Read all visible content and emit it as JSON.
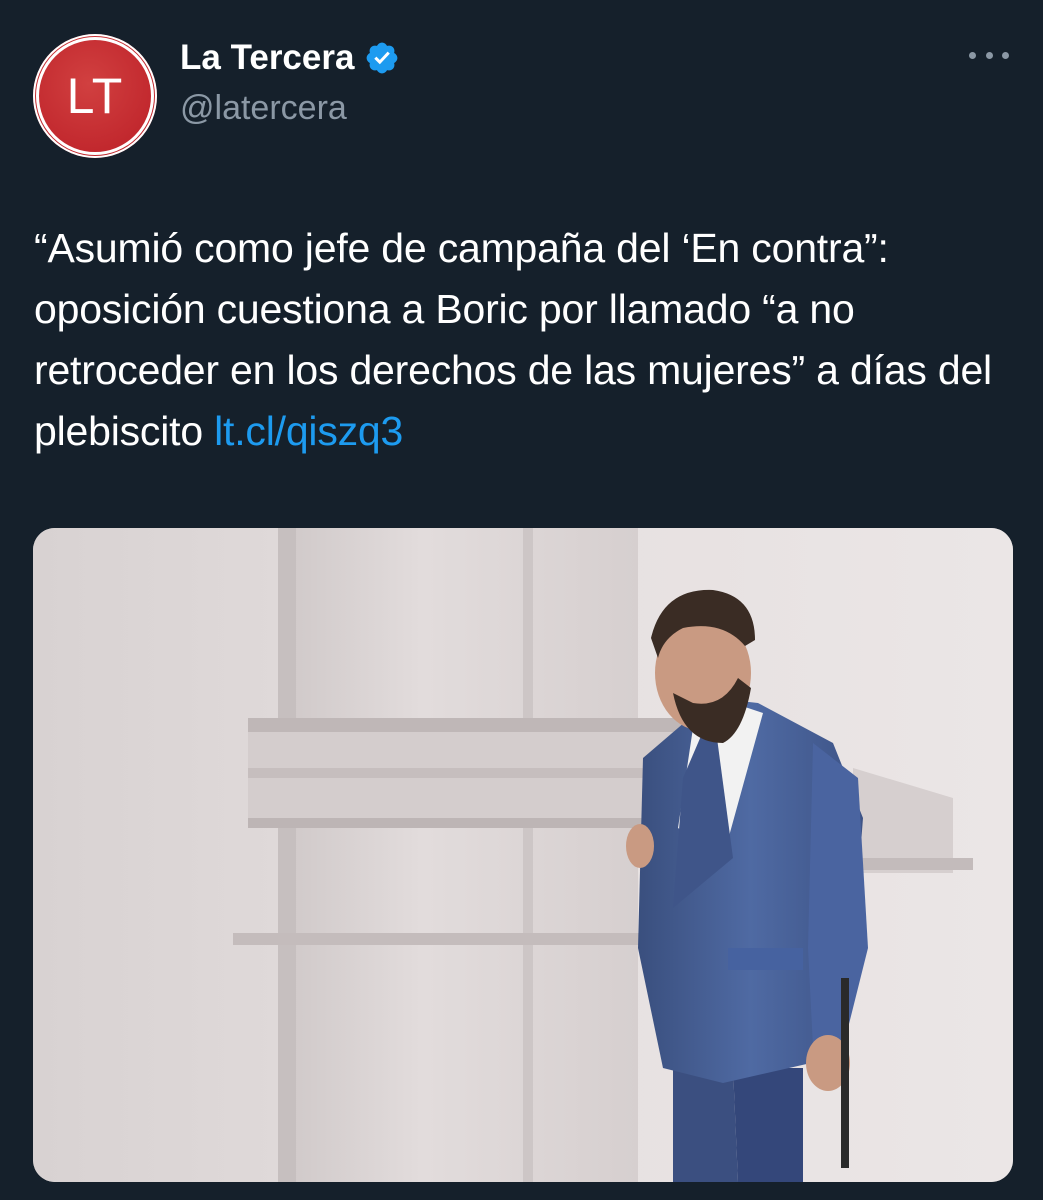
{
  "account": {
    "avatar_text": "LT",
    "display_name": "La Tercera",
    "handle": "@latercera",
    "verified": true,
    "verified_icon": "verified-badge-icon",
    "more_icon": "more-options-icon"
  },
  "tweet": {
    "text": "“Asumió como jefe de campaña del ‘En contra”: oposición cuestiona a Boric por llamado “a no retroceder en los derechos de las mujeres” a días del plebiscito ",
    "link": "lt.cl/qiszq3"
  },
  "media": {
    "type": "photo"
  },
  "colors": {
    "background": "#15202b",
    "text": "#ffffff",
    "secondary_text": "#8b98a5",
    "link": "#1d9bf0",
    "avatar": "#c1272d",
    "verified": "#1d9bf0"
  }
}
